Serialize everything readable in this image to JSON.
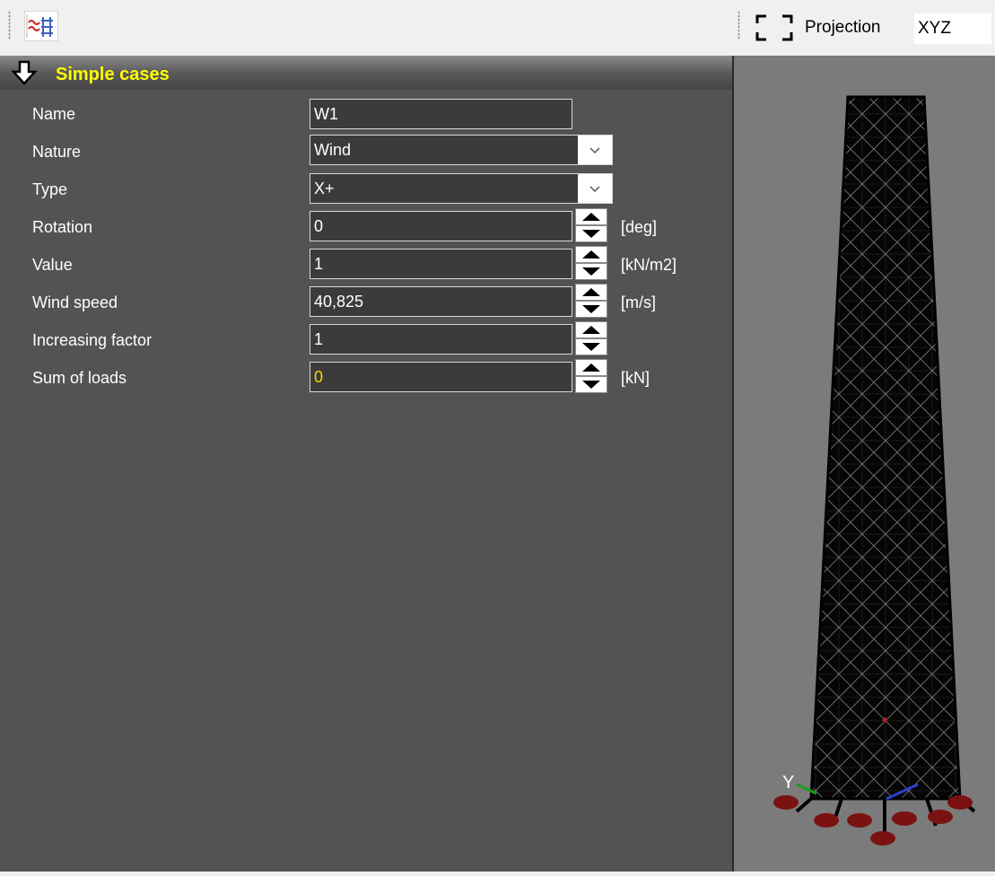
{
  "toolbar": {
    "tool_icon": "load-graph-icon",
    "projection_label": "Projection",
    "projection_value": "XYZ"
  },
  "section": {
    "title": "Simple cases"
  },
  "rows": {
    "name": {
      "label": "Name",
      "value": "W1"
    },
    "nature": {
      "label": "Nature",
      "value": "Wind"
    },
    "type": {
      "label": "Type",
      "value": "X+"
    },
    "rotation": {
      "label": "Rotation",
      "value": "0",
      "unit": "[deg]"
    },
    "value": {
      "label": "Value",
      "value": "1",
      "unit": "[kN/m2]"
    },
    "wind_speed": {
      "label": "Wind speed",
      "value": "40,825",
      "unit": "[m/s]"
    },
    "increasing_factor": {
      "label": "Increasing factor",
      "value": "1"
    },
    "sum_of_loads": {
      "label": "Sum of loads",
      "value": "0",
      "unit": "[kN]"
    }
  },
  "viewport": {
    "axis_label": "Y"
  },
  "colors": {
    "panel_bg": "#535353",
    "field_bg": "#3b3b3b",
    "header_text": "#ffff00",
    "sum_value": "#ffd200",
    "viewport_bg": "#7b7b7b"
  }
}
